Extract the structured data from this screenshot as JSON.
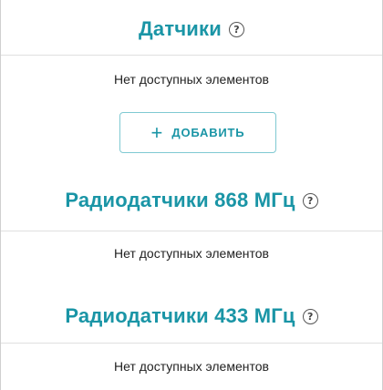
{
  "sections": [
    {
      "title": "Датчики",
      "empty_text": "Нет доступных элементов",
      "add_button": {
        "plus": "+",
        "label": "ДОБАВИТЬ"
      }
    },
    {
      "title": "Радиодатчики 868 МГц",
      "empty_text": "Нет доступных элементов"
    },
    {
      "title": "Радиодатчики 433 МГц",
      "empty_text": "Нет доступных элементов"
    }
  ],
  "help_icon_glyph": "?",
  "colors": {
    "accent": "#1a95a6",
    "button_border": "#7fc9d2"
  }
}
